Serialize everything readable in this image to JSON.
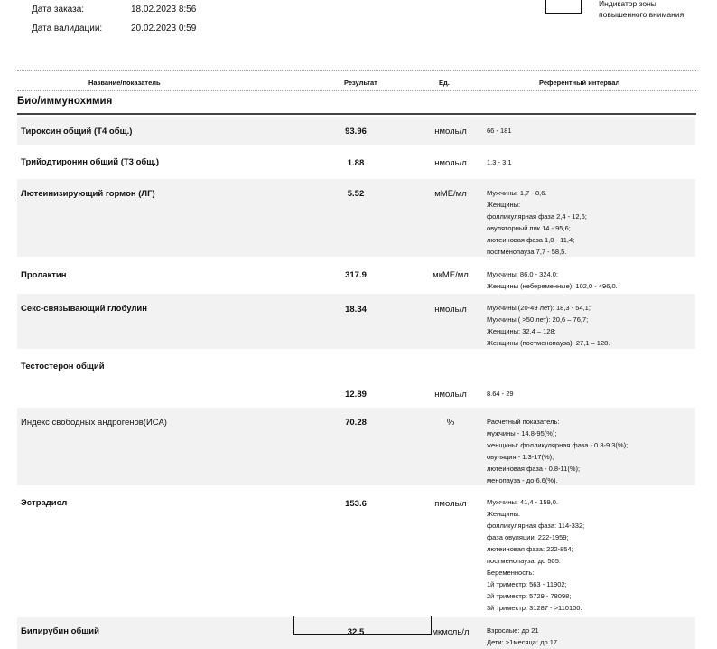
{
  "meta": {
    "order_date_label": "Дата заказа:",
    "order_date_value": "18.02.2023  8:56",
    "validation_date_label": "Дата валидации:",
    "validation_date_value": "20.02.2023  0:59",
    "indicator_text_1": "Индикатор зоны",
    "indicator_text_2": "повышенного внимания"
  },
  "table_header": {
    "name": "Название/показатель",
    "result": "Результат",
    "unit": "Ед.",
    "reference": "Референтный интервал"
  },
  "section": {
    "title": "Био/иммунохимия"
  },
  "rows": [
    {
      "name": "Тироксин общий (Т4 общ.)",
      "result": "93.96",
      "unit": "нмоль/л",
      "ref": [
        "66 - 181"
      ]
    },
    {
      "name": "Трийодтиронин общий (Т3 общ.)",
      "result": "1.88",
      "unit": "нмоль/л",
      "ref": [
        "1.3 - 3.1"
      ]
    },
    {
      "name": "Лютеинизирующий гормон (ЛГ)",
      "result": "5.52",
      "unit": "мМЕ/мл",
      "ref": [
        "Мужчины:  1,7 - 8,6.",
        "Женщины:",
        "фолликулярная фаза  2,4 - 12,6;",
        "овуляторный пик  14 - 95,6;",
        "лютеиновая фаза  1,0 - 11,4;",
        "постменопауза  7,7 - 58,5."
      ]
    },
    {
      "name": "Пролактин",
      "result": "317.9",
      "unit": "мкМЕ/мл",
      "ref": [
        "Мужчины: 86,0 - 324,0;",
        "Женщины (небеременные): 102,0 - 496,0."
      ]
    },
    {
      "name": "Секс-связывающий глобулин",
      "result": "18.34",
      "unit": "нмоль/л",
      "ref": [
        "Мужчины (20-49 лет): 18,3 - 54,1;",
        "Мужчины ( >50 лет): 20,6 – 76,7;",
        "Женщины: 32,4 – 128;",
        "Женщины (постменопауза): 27,1 – 128."
      ]
    },
    {
      "name": "Тестостерон общий",
      "result": "12.89",
      "unit": "нмоль/л",
      "ref": [
        "8.64 - 29"
      ]
    },
    {
      "name": "Индекс свободных андрогенов(ИСА)",
      "result": "70.28",
      "unit": "%",
      "ref": [
        "Расчетный показатель:",
        "мужчины - 14.8-95(%);",
        "женщины:  фолликулярная фаза - 0.8-9.3(%);",
        "овуляция - 1.3-17(%);",
        "лютеиновая фаза - 0.8-11(%);",
        "менопауза - до 6.6(%)."
      ]
    },
    {
      "name": "Эстрадиол",
      "result": "153.6",
      "unit": "пмоль/л",
      "ref": [
        "Мужчины: 41,4 - 159,0.",
        "Женщины:",
        "фолликулярная фаза:  114-332;",
        "фаза овуляции:  222-1959;",
        "лютеиновая фаза:  222-854;",
        "постменопауза:  до 505.",
        "Беременность:",
        "1й триместр: 563 - 11902;",
        "2й триместр: 5729 - 78098;",
        "3й триместр: 31287 - >110100."
      ]
    },
    {
      "name": "Билирубин общий",
      "result": "32.5",
      "unit": "мкмоль/л",
      "ref": [
        "Взрослые: до 21",
        "Дети: >1месяца: до 17"
      ]
    }
  ]
}
